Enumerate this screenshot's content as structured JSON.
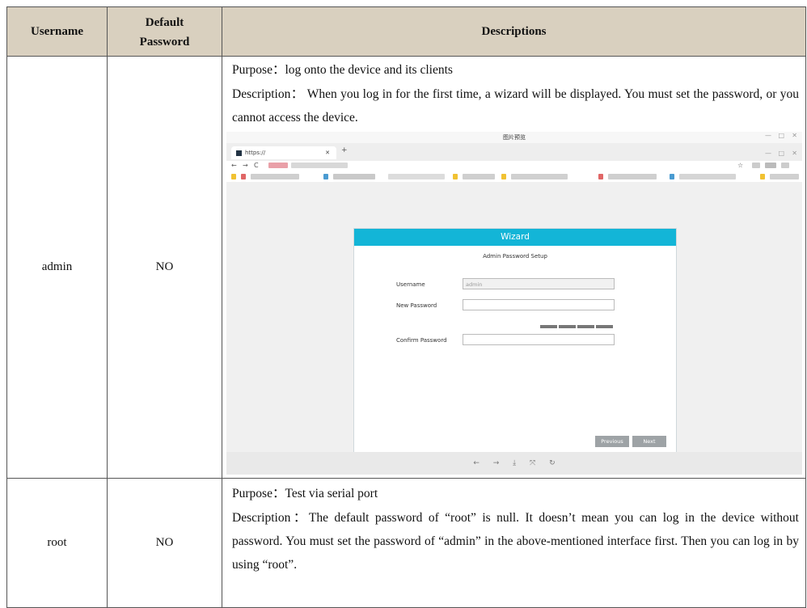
{
  "table": {
    "headers": {
      "username": "Username",
      "default_password_line1": "Default",
      "default_password_line2": "Password",
      "descriptions": "Descriptions"
    },
    "rows": [
      {
        "username": "admin",
        "default_password": "NO",
        "purpose": "Purpose：log onto the device and its clients",
        "description": "Description：  When you log in for the first time, a wizard will be displayed. You must set the password, or you cannot access the device."
      },
      {
        "username": "root",
        "default_password": "NO",
        "purpose": "Purpose：Test via serial port",
        "description": "Description：The default password of “root” is null. It doesn’t mean you can log in the device without password. You must set the password of “admin” in the above-mentioned interface first. Then you can log in by using “root”."
      }
    ]
  },
  "screenshot": {
    "window_title": "图片预览",
    "tab_title": "https://",
    "wizard": {
      "title": "Wizard",
      "subtitle": "Admin Password Setup",
      "username_label": "Username",
      "username_value": "admin",
      "new_password_label": "New Password",
      "confirm_password_label": "Confirm Password",
      "previous_button": "Previous",
      "next_button": "Next"
    },
    "colors": {
      "wizard_header": "#13b5d7",
      "table_header": "#d9d0bf"
    }
  }
}
